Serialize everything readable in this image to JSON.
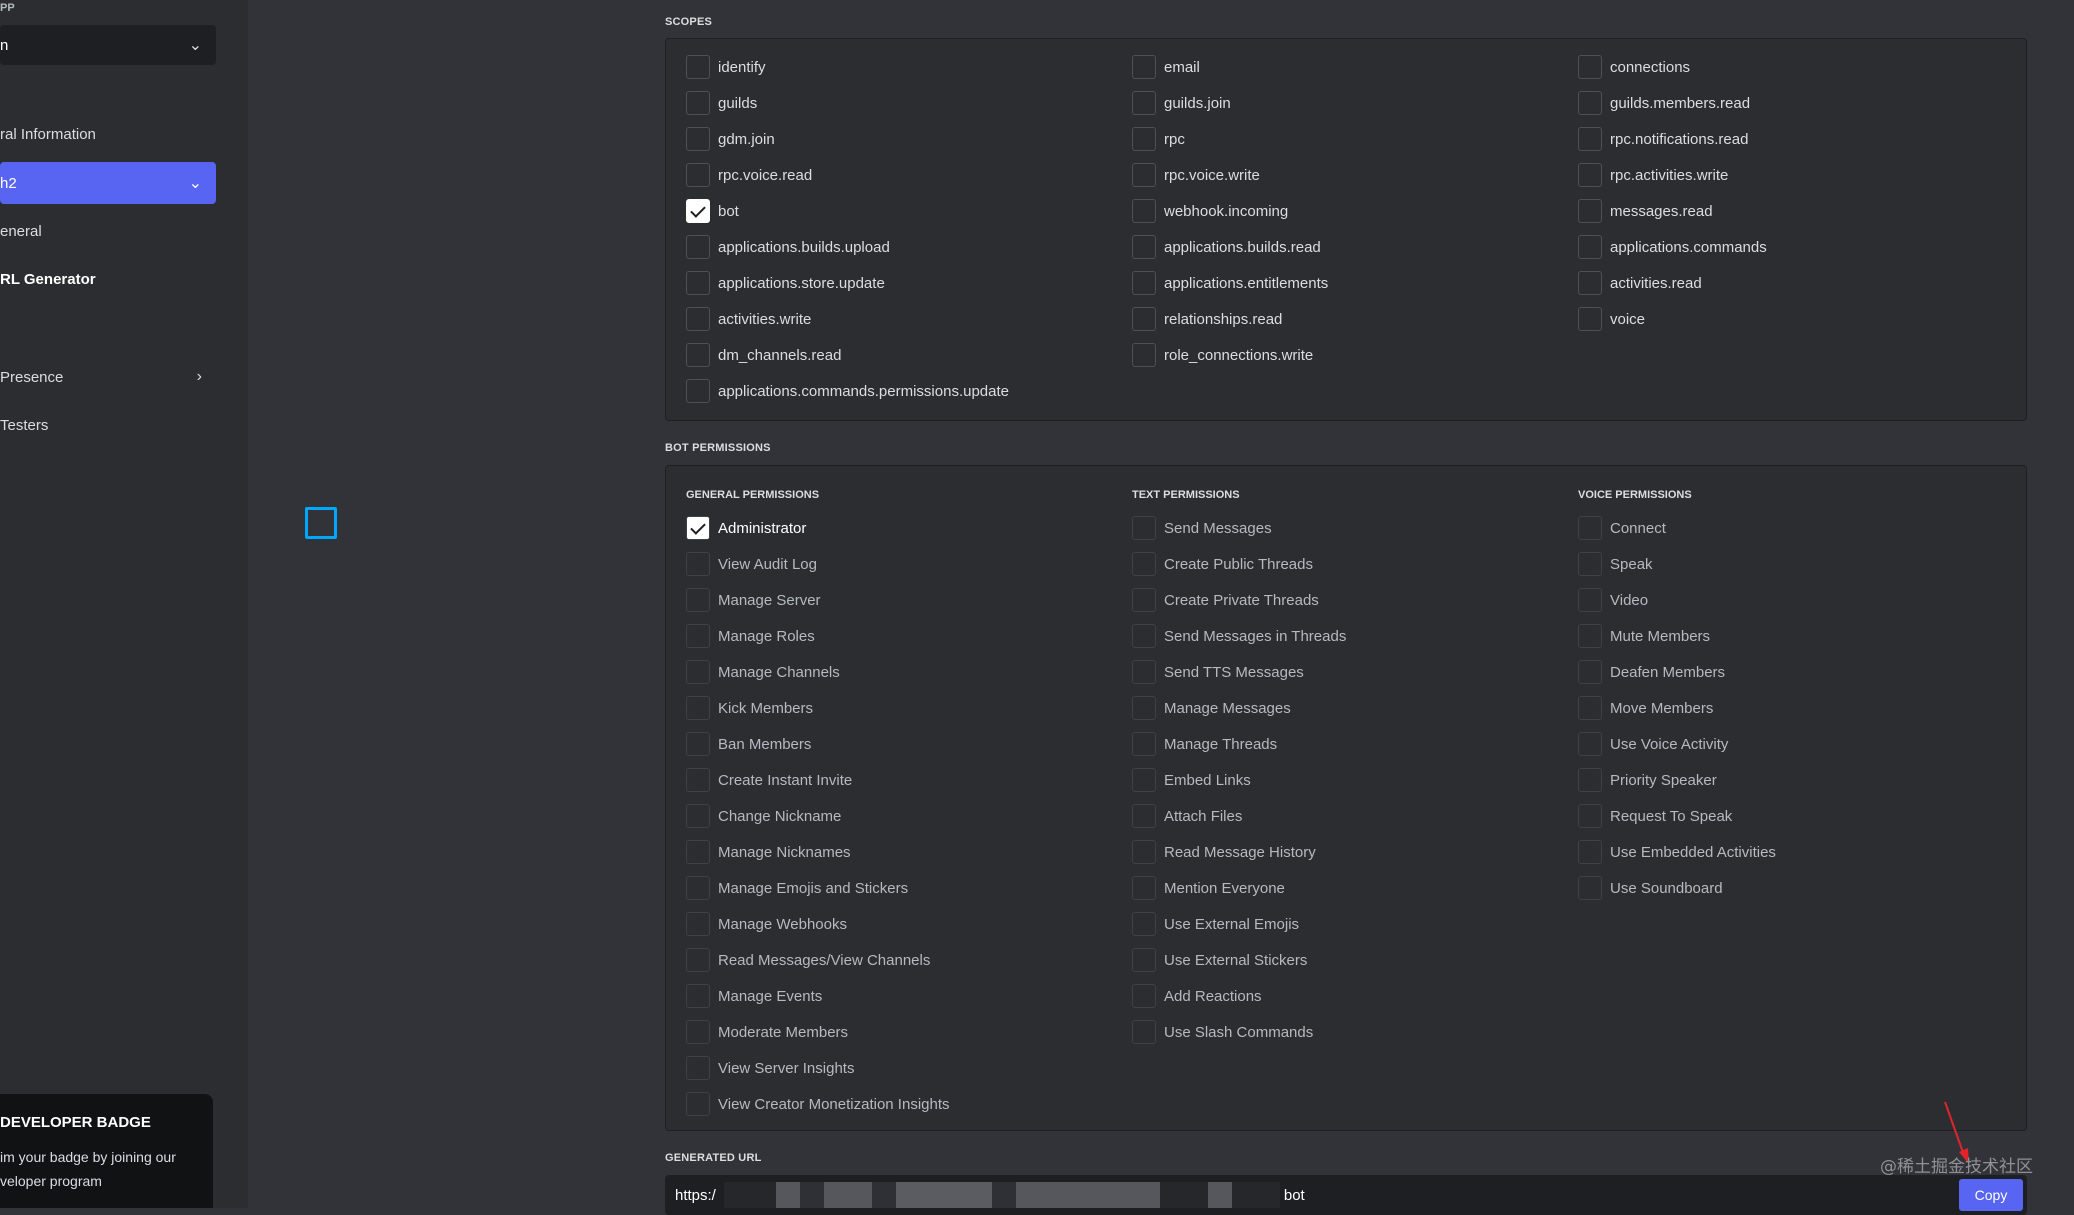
{
  "sidebar": {
    "app_label": "PP",
    "app_select": "n",
    "items": [
      {
        "label": "ral Information"
      },
      {
        "label": "h2"
      },
      {
        "label": "eneral"
      },
      {
        "label": "RL Generator"
      },
      {
        "label": "Presence"
      },
      {
        "label": "Testers"
      }
    ],
    "badge": {
      "title": "DEVELOPER BADGE",
      "desc_line1": "im your badge by joining our",
      "desc_line2": "veloper program"
    }
  },
  "scopes": {
    "label": "SCOPES",
    "columns": [
      [
        {
          "label": "identify",
          "checked": false
        },
        {
          "label": "guilds",
          "checked": false
        },
        {
          "label": "gdm.join",
          "checked": false
        },
        {
          "label": "rpc.voice.read",
          "checked": false
        },
        {
          "label": "bot",
          "checked": true
        },
        {
          "label": "applications.builds.upload",
          "checked": false
        },
        {
          "label": "applications.store.update",
          "checked": false
        },
        {
          "label": "activities.write",
          "checked": false
        },
        {
          "label": "dm_channels.read",
          "checked": false
        },
        {
          "label": "applications.commands.permissions.update",
          "checked": false
        }
      ],
      [
        {
          "label": "email",
          "checked": false
        },
        {
          "label": "guilds.join",
          "checked": false
        },
        {
          "label": "rpc",
          "checked": false
        },
        {
          "label": "rpc.voice.write",
          "checked": false
        },
        {
          "label": "webhook.incoming",
          "checked": false
        },
        {
          "label": "applications.builds.read",
          "checked": false
        },
        {
          "label": "applications.entitlements",
          "checked": false
        },
        {
          "label": "relationships.read",
          "checked": false
        },
        {
          "label": "role_connections.write",
          "checked": false
        }
      ],
      [
        {
          "label": "connections",
          "checked": false
        },
        {
          "label": "guilds.members.read",
          "checked": false
        },
        {
          "label": "rpc.notifications.read",
          "checked": false
        },
        {
          "label": "rpc.activities.write",
          "checked": false
        },
        {
          "label": "messages.read",
          "checked": false
        },
        {
          "label": "applications.commands",
          "checked": false
        },
        {
          "label": "activities.read",
          "checked": false
        },
        {
          "label": "voice",
          "checked": false
        }
      ]
    ]
  },
  "bot_permissions": {
    "label": "BOT PERMISSIONS",
    "columns": [
      {
        "heading": "GENERAL PERMISSIONS",
        "items": [
          {
            "label": "Administrator",
            "checked": true
          },
          {
            "label": "View Audit Log",
            "checked": false
          },
          {
            "label": "Manage Server",
            "checked": false
          },
          {
            "label": "Manage Roles",
            "checked": false
          },
          {
            "label": "Manage Channels",
            "checked": false
          },
          {
            "label": "Kick Members",
            "checked": false
          },
          {
            "label": "Ban Members",
            "checked": false
          },
          {
            "label": "Create Instant Invite",
            "checked": false
          },
          {
            "label": "Change Nickname",
            "checked": false
          },
          {
            "label": "Manage Nicknames",
            "checked": false
          },
          {
            "label": "Manage Emojis and Stickers",
            "checked": false
          },
          {
            "label": "Manage Webhooks",
            "checked": false
          },
          {
            "label": "Read Messages/View Channels",
            "checked": false
          },
          {
            "label": "Manage Events",
            "checked": false
          },
          {
            "label": "Moderate Members",
            "checked": false
          },
          {
            "label": "View Server Insights",
            "checked": false
          },
          {
            "label": "View Creator Monetization Insights",
            "checked": false
          }
        ]
      },
      {
        "heading": "TEXT PERMISSIONS",
        "items": [
          {
            "label": "Send Messages",
            "checked": false
          },
          {
            "label": "Create Public Threads",
            "checked": false
          },
          {
            "label": "Create Private Threads",
            "checked": false
          },
          {
            "label": "Send Messages in Threads",
            "checked": false
          },
          {
            "label": "Send TTS Messages",
            "checked": false
          },
          {
            "label": "Manage Messages",
            "checked": false
          },
          {
            "label": "Manage Threads",
            "checked": false
          },
          {
            "label": "Embed Links",
            "checked": false
          },
          {
            "label": "Attach Files",
            "checked": false
          },
          {
            "label": "Read Message History",
            "checked": false
          },
          {
            "label": "Mention Everyone",
            "checked": false
          },
          {
            "label": "Use External Emojis",
            "checked": false
          },
          {
            "label": "Use External Stickers",
            "checked": false
          },
          {
            "label": "Add Reactions",
            "checked": false
          },
          {
            "label": "Use Slash Commands",
            "checked": false
          }
        ]
      },
      {
        "heading": "VOICE PERMISSIONS",
        "items": [
          {
            "label": "Connect",
            "checked": false
          },
          {
            "label": "Speak",
            "checked": false
          },
          {
            "label": "Video",
            "checked": false
          },
          {
            "label": "Mute Members",
            "checked": false
          },
          {
            "label": "Deafen Members",
            "checked": false
          },
          {
            "label": "Move Members",
            "checked": false
          },
          {
            "label": "Use Voice Activity",
            "checked": false
          },
          {
            "label": "Priority Speaker",
            "checked": false
          },
          {
            "label": "Request To Speak",
            "checked": false
          },
          {
            "label": "Use Embedded Activities",
            "checked": false
          },
          {
            "label": "Use Soundboard",
            "checked": false
          }
        ]
      }
    ]
  },
  "generated_url": {
    "label": "GENERATED URL",
    "prefix": "https:/",
    "suffix": "bot",
    "copy_label": "Copy"
  },
  "watermark": "@稀土掘金技术社区"
}
